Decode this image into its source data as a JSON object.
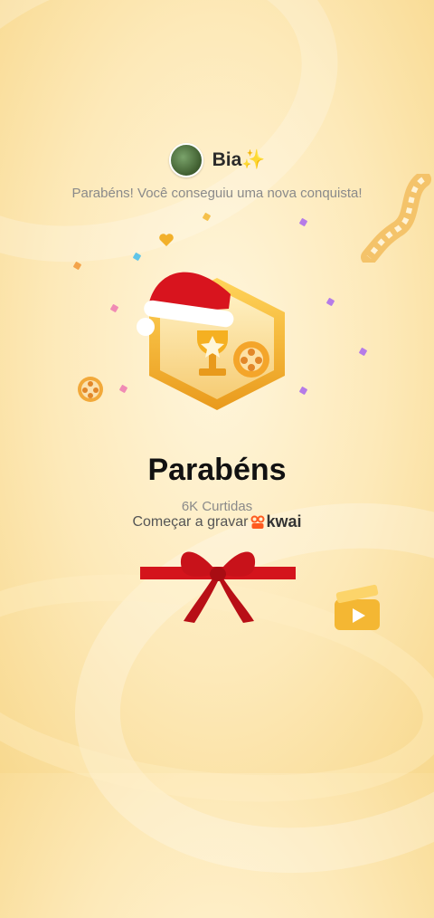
{
  "profile": {
    "username": "Bia✨"
  },
  "message": {
    "subtitle": "Parabéns! Você conseguiu uma nova conquista!",
    "title": "Parabéns",
    "likes": "6K Curtidas",
    "record_prompt": "Começar a gravar",
    "brand": "kwai"
  },
  "icons": {
    "avatar": "avatar-image",
    "badge": "trophy-badge-icon",
    "hat": "santa-hat-icon",
    "film_reel": "film-reel-icon",
    "film_strip": "film-strip-icon",
    "clapper": "clapperboard-icon",
    "brand_logo": "kwai-logo-icon",
    "gift_ribbon": "ribbon-bow-icon"
  },
  "colors": {
    "background": "#fde9b8",
    "title": "#111111",
    "muted": "#8a8a8a",
    "gold": "#f2b02a",
    "ribbon_red": "#d4141c",
    "kwai_orange": "#ff5a1f"
  }
}
